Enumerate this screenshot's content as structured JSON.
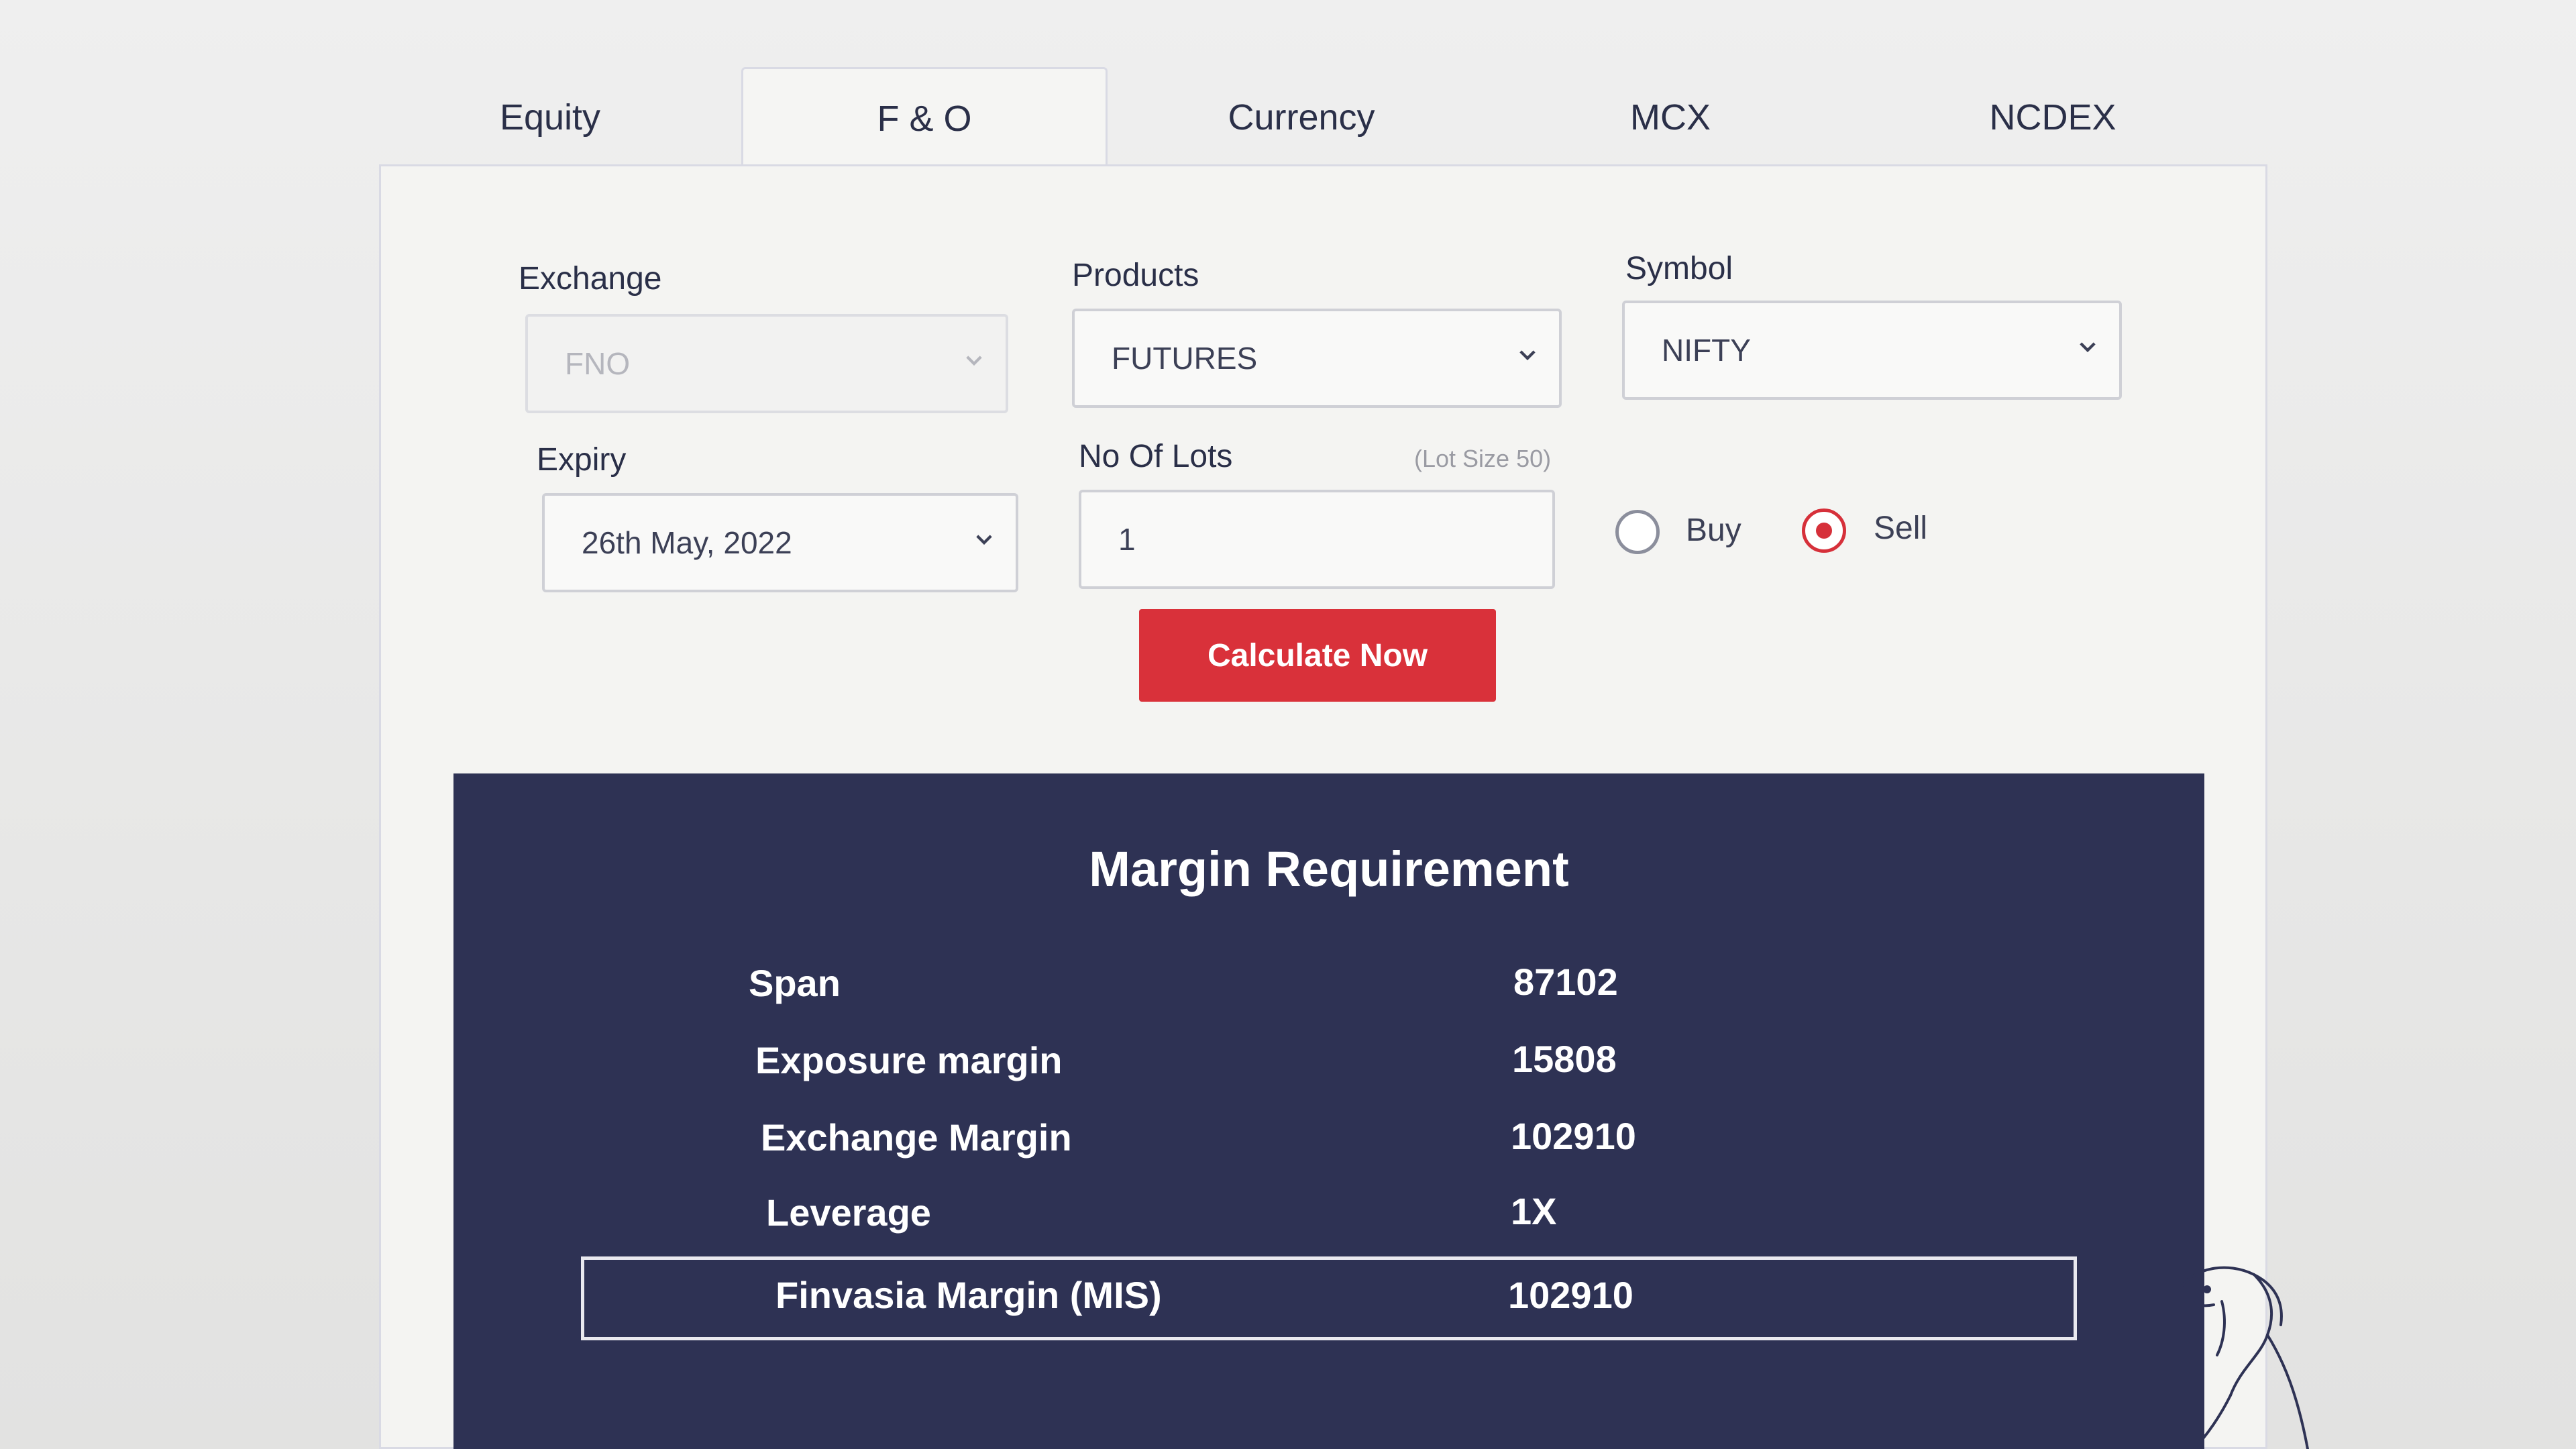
{
  "tabs": [
    {
      "label": "Equity"
    },
    {
      "label": "F & O"
    },
    {
      "label": "Currency"
    },
    {
      "label": "MCX"
    },
    {
      "label": "NCDEX"
    }
  ],
  "active_tab": "F & O",
  "form": {
    "exchange": {
      "label": "Exchange",
      "value": "FNO"
    },
    "products": {
      "label": "Products",
      "value": "FUTURES"
    },
    "symbol": {
      "label": "Symbol",
      "value": "NIFTY"
    },
    "expiry": {
      "label": "Expiry",
      "value": "26th May, 2022"
    },
    "lots": {
      "label": "No Of Lots",
      "lot_size_note": "(Lot Size 50)",
      "value": "1"
    },
    "side": {
      "options": [
        {
          "label": "Buy"
        },
        {
          "label": "Sell"
        }
      ],
      "selected": "Sell"
    },
    "calculate_label": "Calculate Now"
  },
  "results": {
    "title": "Margin Requirement",
    "rows": [
      {
        "label": "Span",
        "value": "87102"
      },
      {
        "label": "Exposure margin",
        "value": "15808"
      },
      {
        "label": "Exchange Margin",
        "value": "102910"
      },
      {
        "label": "Leverage",
        "value": "1X"
      },
      {
        "label": "Finvasia Margin (MIS)",
        "value": "102910"
      }
    ]
  },
  "colors": {
    "accent": "#d9313a",
    "panel": "#2e3254",
    "text": "#2a2f48"
  }
}
